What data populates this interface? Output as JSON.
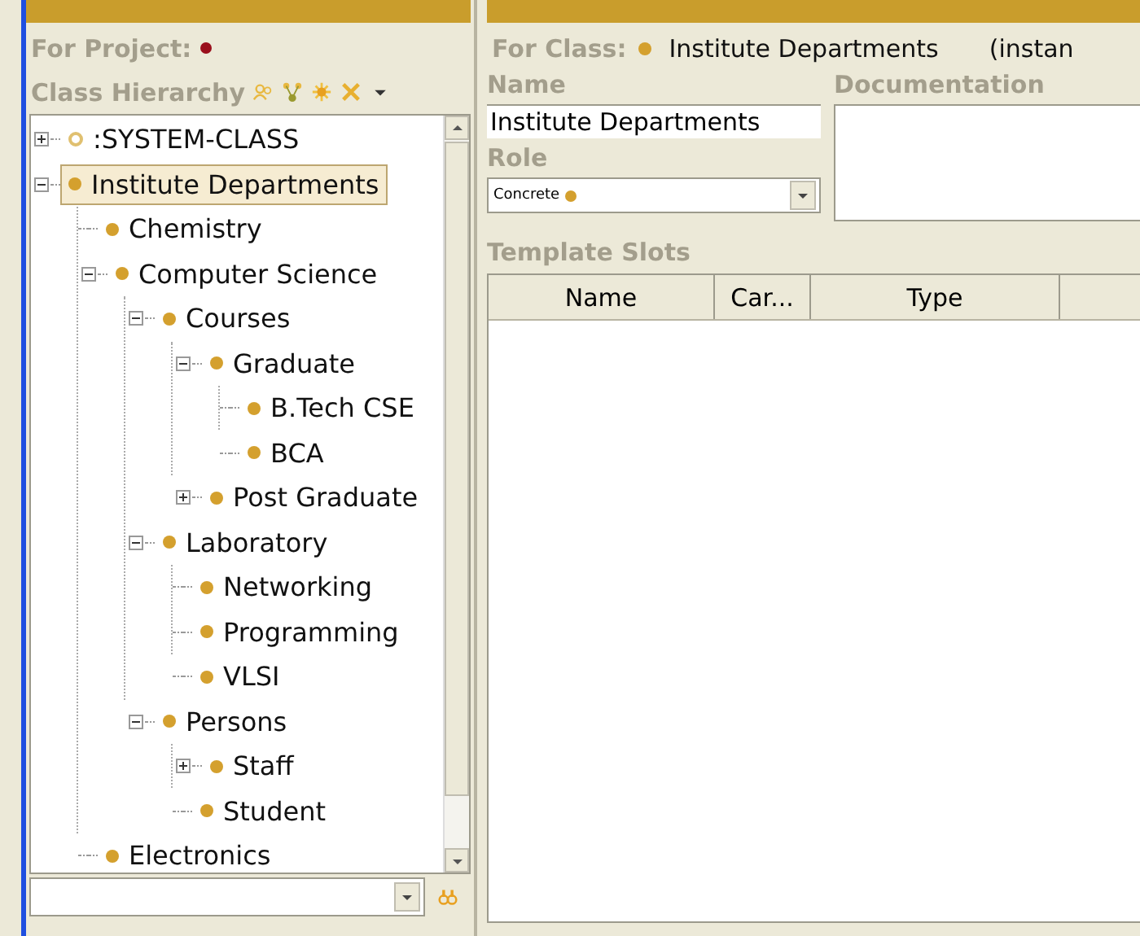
{
  "class_browser": {
    "project_label": "For Project:",
    "hierarchy_label": "Class Hierarchy",
    "tree": [
      {
        "label": ":SYSTEM-CLASS",
        "kind": "system",
        "expanded": false,
        "selected": false
      },
      {
        "label": "Institute Departments",
        "kind": "concrete",
        "expanded": true,
        "selected": true,
        "children": [
          {
            "label": "Chemistry",
            "kind": "concrete",
            "selected": false
          },
          {
            "label": "Computer Science",
            "kind": "concrete",
            "expanded": true,
            "selected": false,
            "children": [
              {
                "label": "Courses",
                "kind": "concrete",
                "expanded": true,
                "selected": false,
                "children": [
                  {
                    "label": "Graduate",
                    "kind": "concrete",
                    "expanded": true,
                    "selected": false,
                    "children": [
                      {
                        "label": "B.Tech CSE",
                        "kind": "concrete",
                        "selected": false
                      },
                      {
                        "label": "BCA",
                        "kind": "concrete",
                        "selected": false
                      }
                    ]
                  },
                  {
                    "label": "Post Graduate",
                    "kind": "concrete",
                    "expanded": false,
                    "selected": false
                  }
                ]
              },
              {
                "label": "Laboratory",
                "kind": "concrete",
                "expanded": true,
                "selected": false,
                "children": [
                  {
                    "label": "Networking",
                    "kind": "concrete",
                    "selected": false
                  },
                  {
                    "label": "Programming",
                    "kind": "concrete",
                    "selected": false
                  },
                  {
                    "label": "VLSI",
                    "kind": "concrete",
                    "selected": false
                  }
                ]
              },
              {
                "label": "Persons",
                "kind": "concrete",
                "expanded": true,
                "selected": false,
                "children": [
                  {
                    "label": "Staff",
                    "kind": "concrete",
                    "expanded": false,
                    "selected": false
                  },
                  {
                    "label": "Student",
                    "kind": "concrete",
                    "selected": false
                  }
                ]
              }
            ]
          },
          {
            "label": "Electronics",
            "kind": "concrete",
            "selected": false
          }
        ]
      }
    ]
  },
  "class_editor": {
    "for_class_label": "For Class:",
    "for_class_value": "Institute Departments",
    "instance_note": "(instan",
    "name_label": "Name",
    "name_value": "Institute Departments",
    "documentation_label": "Documentation",
    "role_label": "Role",
    "role_value": "Concrete",
    "template_slots_label": "Template Slots",
    "slot_columns": [
      "Name",
      "Car...",
      "Type"
    ]
  }
}
